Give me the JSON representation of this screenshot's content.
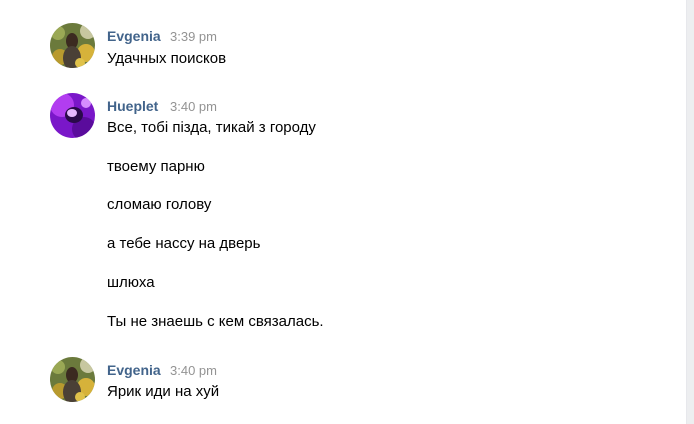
{
  "messages": [
    {
      "author": "Evgenia",
      "time": "3:39 pm",
      "texts": [
        "Удачных поисков"
      ]
    },
    {
      "author": "Hueplet",
      "time": "3:40 pm",
      "texts": [
        "Все, тобі пізда, тикай з городу",
        "твоему парню",
        "сломаю голову",
        "а тебе нассу на дверь",
        "шлюха",
        "Ты не знаешь с кем связалась."
      ]
    },
    {
      "author": "Evgenia",
      "time": "3:40 pm",
      "texts": [
        "Ярик иди на хуй"
      ]
    }
  ],
  "colors": {
    "author": "#42648b",
    "time": "#939393",
    "text": "#000000",
    "background": "#ffffff"
  }
}
